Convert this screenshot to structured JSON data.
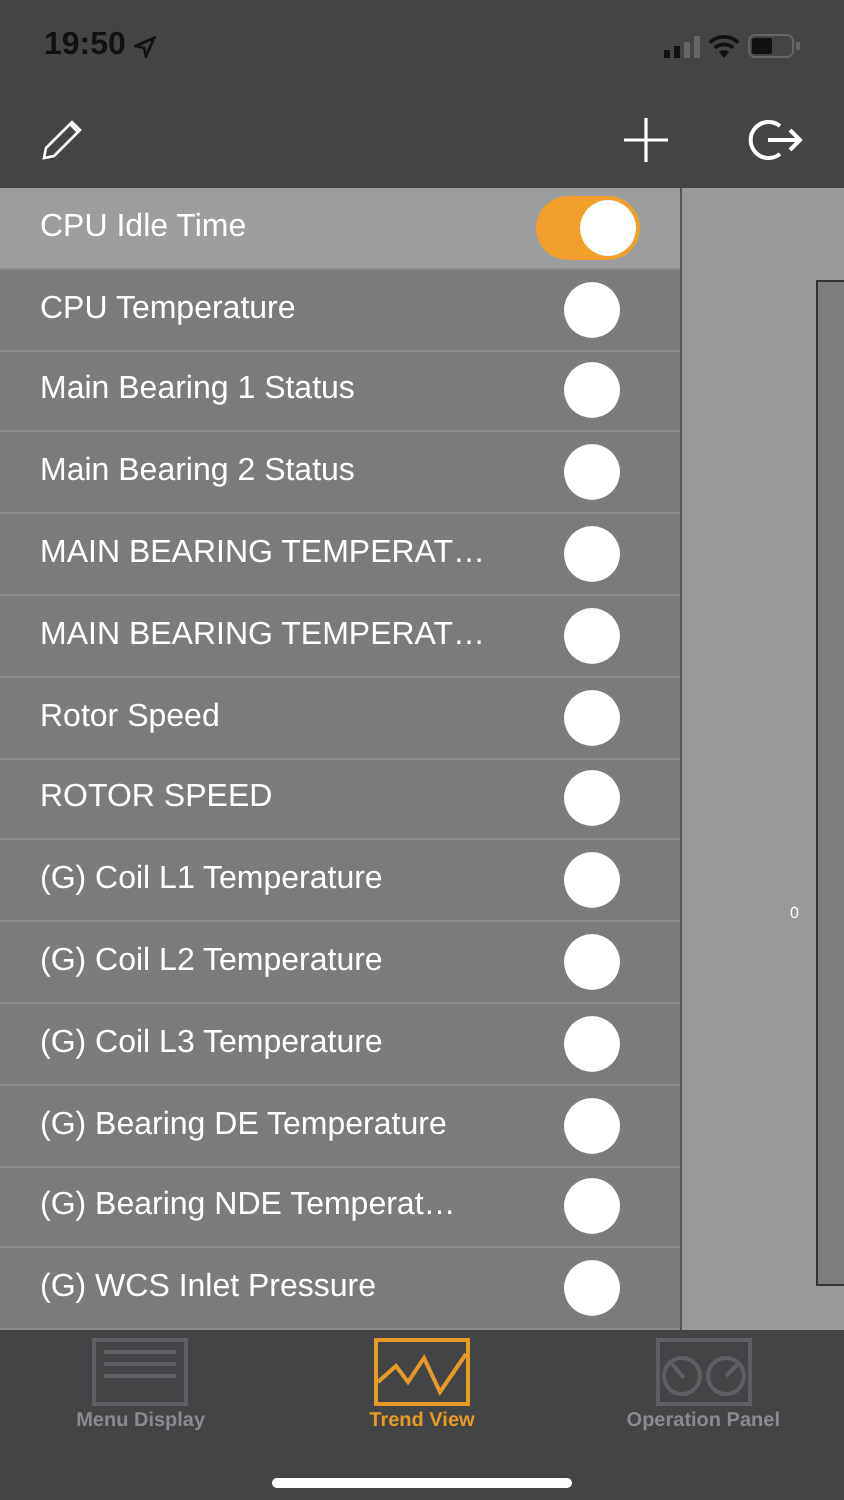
{
  "status_bar": {
    "time": "19:50"
  },
  "items": [
    {
      "label": "CPU Idle Time",
      "selected": true,
      "on": true
    },
    {
      "label": "CPU Temperature",
      "selected": false,
      "on": false
    },
    {
      "label": "Main Bearing 1 Status",
      "selected": false,
      "on": false
    },
    {
      "label": "Main Bearing 2 Status",
      "selected": false,
      "on": false
    },
    {
      "label": "MAIN BEARING TEMPERAT…",
      "selected": false,
      "on": false
    },
    {
      "label": "MAIN BEARING TEMPERAT…",
      "selected": false,
      "on": false
    },
    {
      "label": "Rotor Speed",
      "selected": false,
      "on": false
    },
    {
      "label": "ROTOR SPEED",
      "selected": false,
      "on": false
    },
    {
      "label": "(G) Coil L1 Temperature",
      "selected": false,
      "on": false
    },
    {
      "label": "(G) Coil L2 Temperature",
      "selected": false,
      "on": false
    },
    {
      "label": "(G) Coil L3 Temperature",
      "selected": false,
      "on": false
    },
    {
      "label": "(G) Bearing DE Temperature",
      "selected": false,
      "on": false
    },
    {
      "label": "(G) Bearing NDE Temperat…",
      "selected": false,
      "on": false
    },
    {
      "label": "(G) WCS Inlet Pressure",
      "selected": false,
      "on": false
    }
  ],
  "plot": {
    "axis_label": "0"
  },
  "tabs": [
    {
      "label": "Menu Display",
      "kind": "menu",
      "selected": false
    },
    {
      "label": "Trend View",
      "kind": "trend",
      "selected": true
    },
    {
      "label": "Operation Panel",
      "kind": "gauges",
      "selected": false
    }
  ]
}
